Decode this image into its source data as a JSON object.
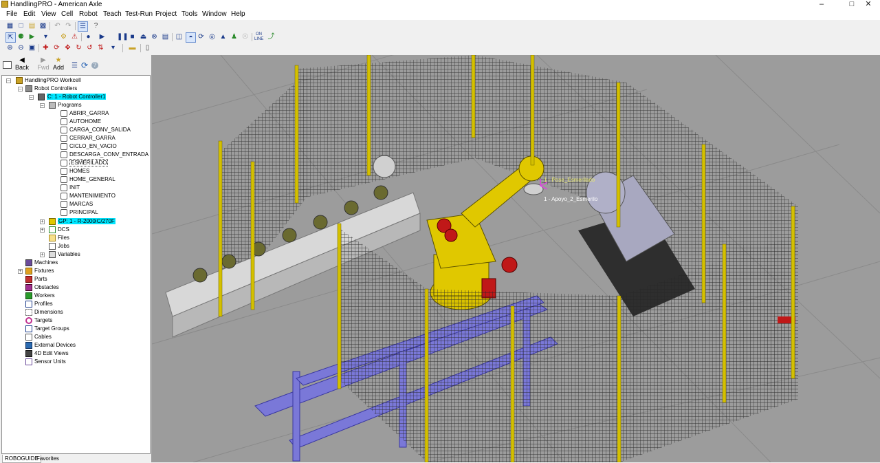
{
  "window": {
    "title": "HandlingPRO - American Axle",
    "icon": "app-icon"
  },
  "menu": [
    "File",
    "Edit",
    "View",
    "Cell",
    "Robot",
    "Teach",
    "Test-Run",
    "Project",
    "Tools",
    "Window",
    "Help"
  ],
  "nav": {
    "back": "Back",
    "fwd": "Fwd",
    "add": "Add"
  },
  "tree": {
    "root": "HandlingPRO Workcell",
    "robot_controllers": "Robot Controllers",
    "controller": "C: 1 - Robot Controller1",
    "programs_label": "Programs",
    "programs": [
      "ABRIR_GARRA",
      "AUTOHOME",
      "CARGA_CONV_SALIDA",
      "CERRAR_GARRA",
      "CICLO_EN_VACIO",
      "DESCARGA_CONV_ENTRADA",
      "ESMERILADO",
      "HOMES",
      "HOME_GENERAL",
      "INIT",
      "MANTENIMIENTO",
      "MARCAS",
      "PRINCIPAL"
    ],
    "group": "GP: 1 - R-2000iC/270F",
    "dcs": "DCS",
    "files": "Files",
    "jobs": "Jobs",
    "variables": "Variables",
    "top_items": [
      "Machines",
      "Fixtures",
      "Parts",
      "Obstacles",
      "Workers",
      "Profiles",
      "Dimensions",
      "Targets",
      "Target Groups",
      "Cables",
      "External Devices",
      "4D Edit Views",
      "Sensor Units"
    ]
  },
  "bottom_tabs": [
    "ROBOGUIDE",
    "Favorites"
  ],
  "viewport": {
    "labels": [
      "1 - Pose_Esmerilado",
      "1 - Apoyo_2_Esmerilo"
    ]
  },
  "colors": {
    "fence": "#2a2a2a",
    "post": "#d4c000",
    "robot": "#e0c800",
    "motor": "#c01818",
    "conveyor": "#7a78d8",
    "floor": "#9c9c9c",
    "highlight": "#00e6ff"
  }
}
